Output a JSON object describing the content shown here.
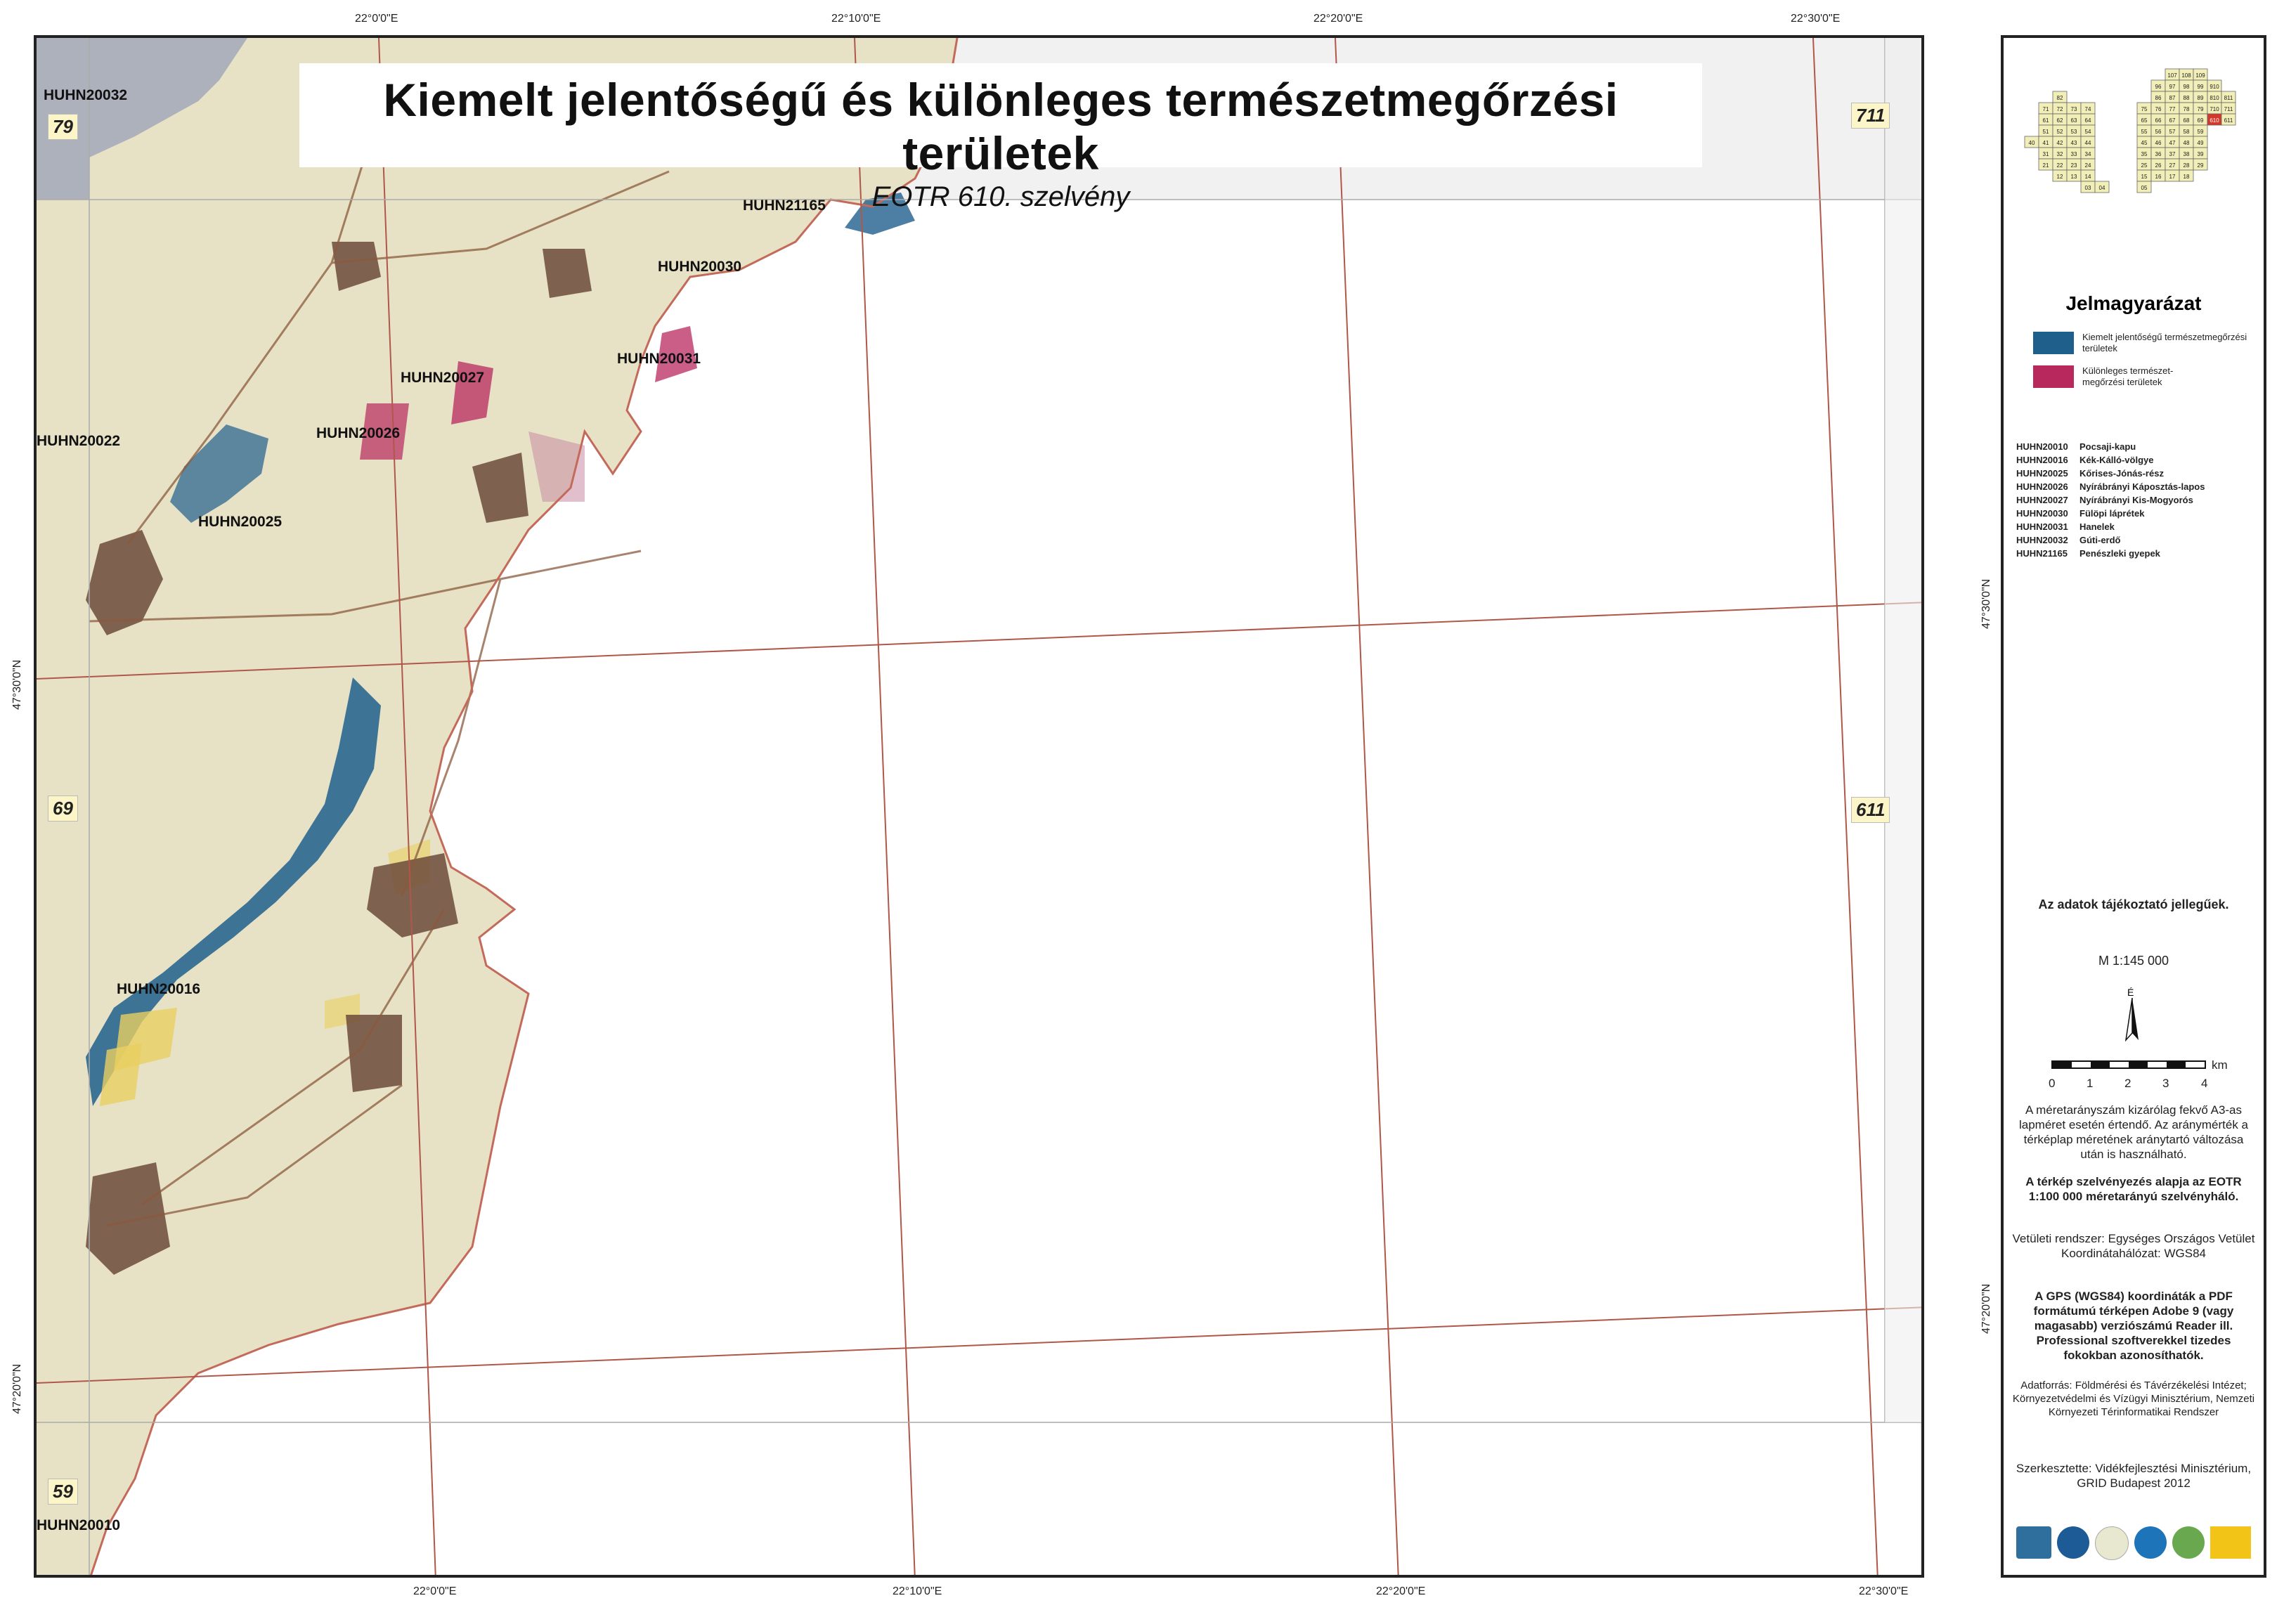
{
  "title": "Kiemelt jelentőségű és különleges természetmegőrzési területek",
  "subtitle": "EOTR 610. szelvény",
  "colors": {
    "kiemelt": "#1f5f8c",
    "kulonleges": "#b8285d",
    "neighbor_sheet_label_bg": "#fbf5c8",
    "index_highlight": "#d4382a",
    "index_filled": "#f2eeb8"
  },
  "coords": {
    "top": [
      "22°0'0\"E",
      "22°10'0\"E",
      "22°20'0\"E",
      "22°30'0\"E"
    ],
    "bottom": [
      "22°0'0\"E",
      "22°10'0\"E",
      "22°20'0\"E",
      "22°30'0\"E"
    ],
    "left": [
      "47°30'0\"N",
      "47°20'0\"N"
    ],
    "right": [
      "47°30'0\"N",
      "47°20'0\"N"
    ]
  },
  "neighbor_sheets": {
    "top_left": "79",
    "mid_left": "69",
    "bottom_left": "59",
    "top_right": "711",
    "mid_right": "611"
  },
  "site_labels": {
    "s20032": "HUHN20032",
    "s21165": "HUHN21165",
    "s20030": "HUHN20030",
    "s20031": "HUHN20031",
    "s20027": "HUHN20027",
    "s20026": "HUHN20026",
    "s20022": "HUHN20022",
    "s20025": "HUHN20025",
    "s20016": "HUHN20016",
    "s20010": "HUHN20010"
  },
  "legend": {
    "title": "Jelmagyarázat",
    "item1": "Kiemelt jelentőségű természetmegőrzési területek",
    "item2": "Különleges természet-megőrzési területek",
    "sites": [
      {
        "code": "HUHN20010",
        "name": "Pocsaji-kapu"
      },
      {
        "code": "HUHN20016",
        "name": "Kék-Kálló-völgye"
      },
      {
        "code": "HUHN20025",
        "name": "Kőrises-Jónás-rész"
      },
      {
        "code": "HUHN20026",
        "name": "Nyírábrányi Káposztás-lapos"
      },
      {
        "code": "HUHN20027",
        "name": "Nyírábrányi Kis-Mogyorós"
      },
      {
        "code": "HUHN20030",
        "name": "Fülöpi láprétek"
      },
      {
        "code": "HUHN20031",
        "name": "Hanelek"
      },
      {
        "code": "HUHN20032",
        "name": "Gúti-erdő"
      },
      {
        "code": "HUHN21165",
        "name": "Penészleki gyepek"
      }
    ]
  },
  "notes": {
    "info": "Az adatok tájékoztató jellegűek.",
    "scale": "M 1:145 000",
    "north": "É",
    "km": "km",
    "ticks": [
      "0",
      "1",
      "2",
      "3",
      "4"
    ],
    "scale_note": "A méretarányszám kizárólag fekvő A3-as lapméret esetén értendő. Az aránymérték a térképlap méretének aránytartó változása után is használható.",
    "grid_note": "A térkép szelvényezés alapja az EOTR 1:100 000 méretarányú szelvényháló.",
    "projection_note": "Vetületi rendszer: Egységes Országos Vetület Koordinátahálózat: WGS84",
    "gps_note": "A GPS (WGS84) koordináták a PDF formátumú térképen Adobe 9 (vagy magasabb) verziószámú Reader ill. Professional szoftverekkel tizedes fokokban azonosíthatók.",
    "source_note": "Adatforrás: Földmérési és Távérzékelési Intézet; Környezetvédelmi és Vízügyi Minisztérium, Nemzeti Környezeti Térinformatikai Rendszer",
    "editor_note": "Szerkesztette: Vidékfejlesztési Minisztérium, GRID Budapest 2012"
  },
  "index_map": {
    "rows": [
      [
        "107",
        "108",
        "109"
      ],
      [
        "96",
        "97",
        "98",
        "99",
        "910"
      ],
      [
        "86",
        "87",
        "88",
        "89",
        "810",
        "811"
      ],
      [
        "75",
        "76",
        "77",
        "78",
        "79",
        "710",
        "711"
      ],
      [
        "65",
        "66",
        "67",
        "68",
        "69",
        "610",
        "611"
      ],
      [
        "55",
        "56",
        "57",
        "58",
        "59"
      ],
      [
        "45",
        "46",
        "47",
        "48",
        "49"
      ],
      [
        "35",
        "36",
        "37",
        "38",
        "39"
      ],
      [
        "25",
        "26",
        "27",
        "28",
        "29"
      ],
      [
        "15",
        "16",
        "17",
        "18"
      ],
      [
        "05"
      ]
    ],
    "left_rows": [
      [
        "82"
      ],
      [
        "71",
        "72",
        "73",
        "74"
      ],
      [
        "61",
        "62",
        "63",
        "64"
      ],
      [
        "51",
        "52",
        "53",
        "54"
      ],
      [
        "40",
        "41",
        "42",
        "43",
        "44"
      ],
      [
        "31",
        "32",
        "33",
        "34"
      ],
      [
        "21",
        "22",
        "23",
        "24"
      ],
      [
        "12",
        "13",
        "14"
      ],
      [
        "03",
        "04"
      ]
    ],
    "highlight": "610"
  }
}
